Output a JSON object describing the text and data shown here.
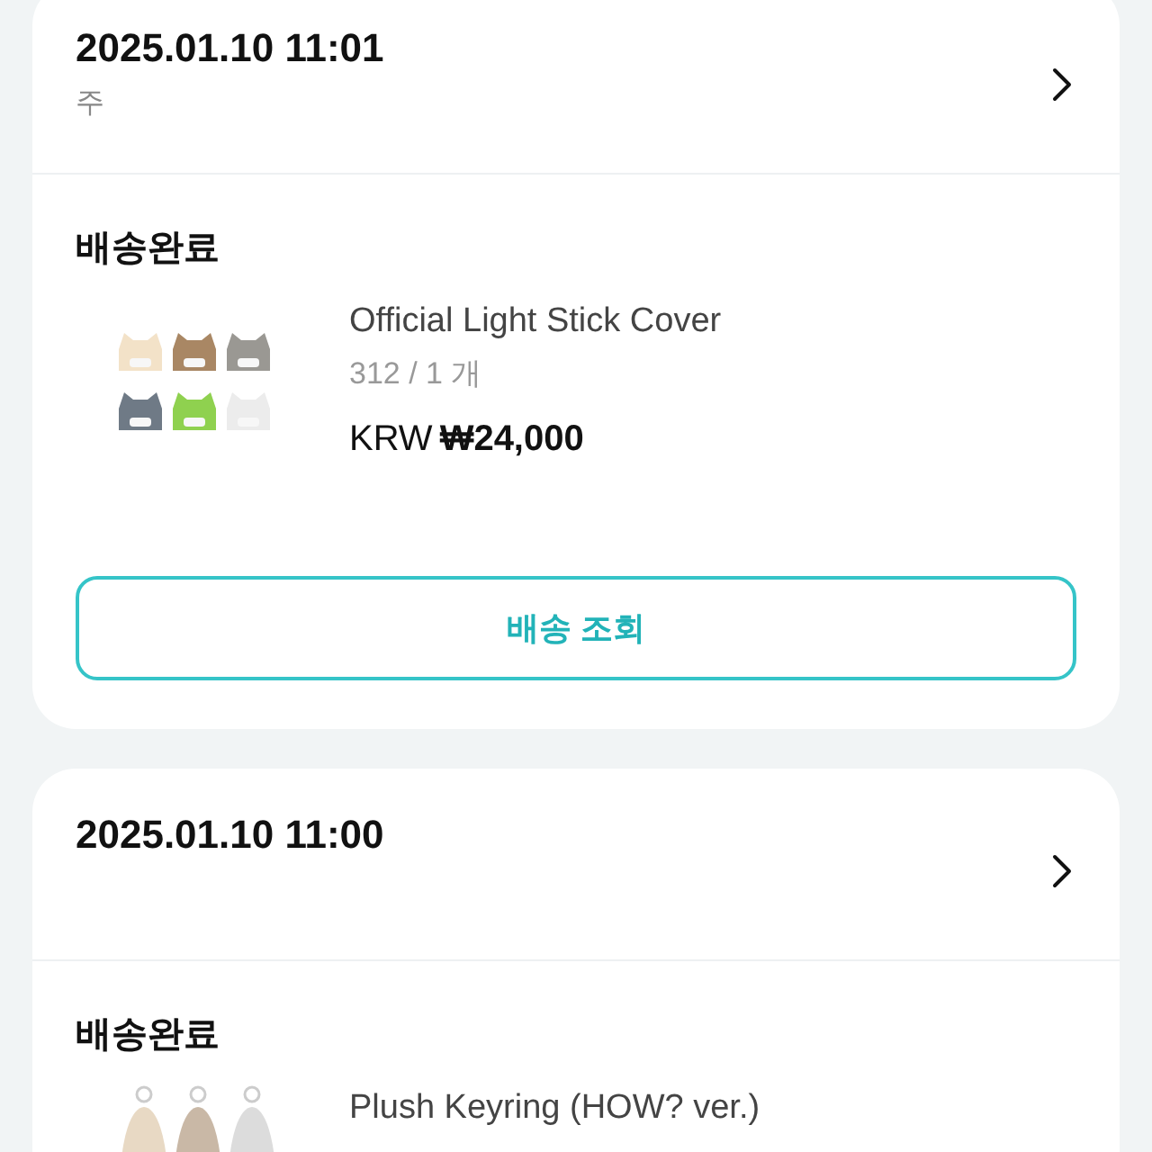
{
  "orders": [
    {
      "date": "2025.01.10 11:01",
      "subtitle": "주",
      "status": "배송완료",
      "product": {
        "name": "Official Light Stick Cover",
        "option": "312 / 1 개",
        "currency": "KRW",
        "price": "₩24,000"
      },
      "button": "배송 조회"
    },
    {
      "date": "2025.01.10 11:00",
      "status": "배송완료",
      "product": {
        "name": "Plush Keyring (HOW? ver.)"
      }
    }
  ]
}
